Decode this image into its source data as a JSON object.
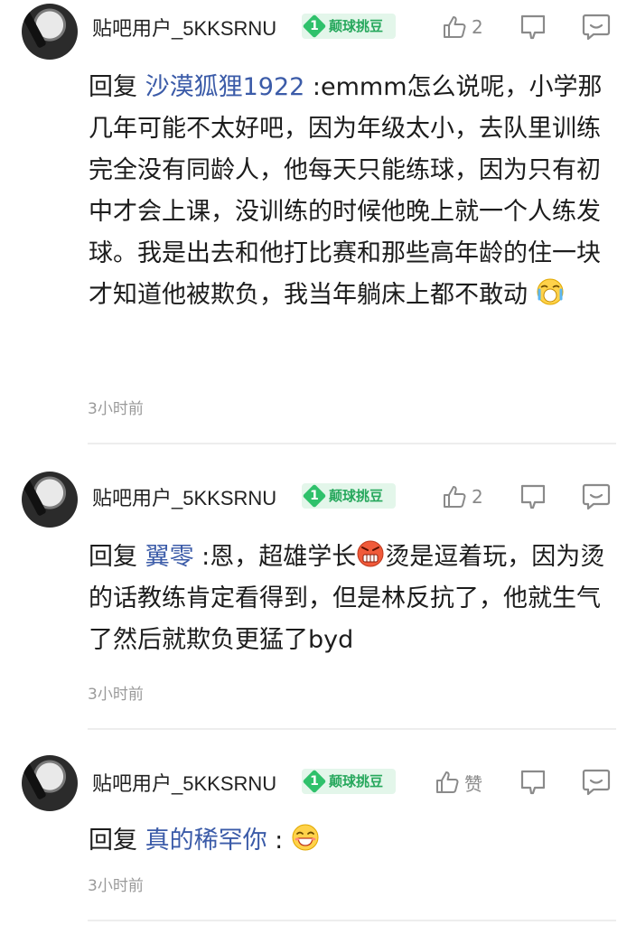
{
  "comments": [
    {
      "username": "贴吧用户_5KKSRNU",
      "badge_level": "1",
      "badge_text": "颠球挑豆",
      "like_label": "2",
      "reply_prefix": "回复",
      "mention": "沙漠狐狸1922",
      "text": " :emmm怎么说呢，小学那几年可能不太好吧，因为年级太小，去队里训练完全没有同龄人，他每天只能练球，因为只有初中才会上课，没训练的时候他晚上就一个人练发球。我是出去和他打比赛和那些高年龄的住一块才知道他被欺负，我当年躺床上都不敢动",
      "emoji": "crying-face-emoji",
      "time": "3小时前"
    },
    {
      "username": "贴吧用户_5KKSRNU",
      "badge_level": "1",
      "badge_text": "颠球挑豆",
      "like_label": "2",
      "reply_prefix": "回复",
      "mention": "翼零",
      "text_before_emoji": " :恩，超雄学长",
      "emoji": "angry-grimace-emoji",
      "text_after_emoji": "烫是逗着玩，因为烫的话教练肯定看得到，但是林反抗了，他就生气了然后就欺负更猛了byd",
      "time": "3小时前"
    },
    {
      "username": "贴吧用户_5KKSRNU",
      "badge_level": "1",
      "badge_text": "颠球挑豆",
      "like_label": "赞",
      "reply_prefix": "回复",
      "mention": "真的稀罕你",
      "text": " :",
      "emoji": "grinning-face-emoji",
      "time": "3小时前"
    }
  ],
  "colors": {
    "mention": "#3b5ba8",
    "badge_bg": "#e3f6ea",
    "badge_text": "#27a85d",
    "muted": "#9a9a9a"
  }
}
